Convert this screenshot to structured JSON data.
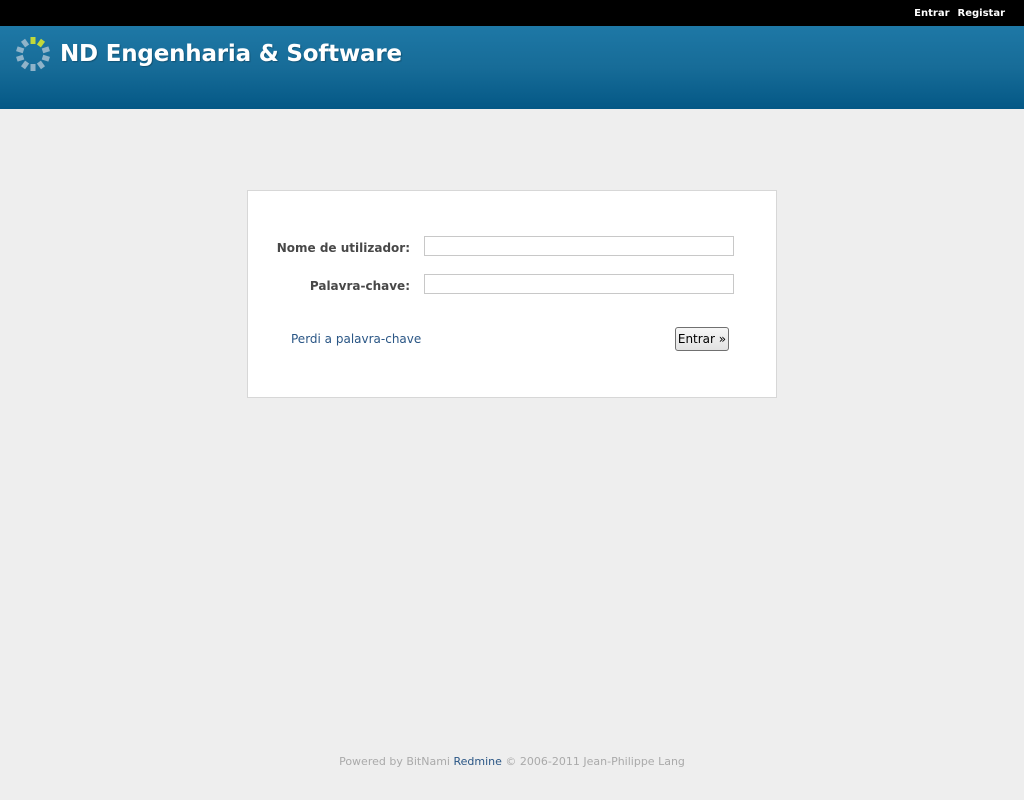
{
  "top_menu": {
    "login_label": "Entrar",
    "register_label": "Registar"
  },
  "header": {
    "title": "ND Engenharia & Software",
    "logo_icon": "spinner-logo-icon"
  },
  "login_form": {
    "username_label": "Nome de utilizador:",
    "username_value": "",
    "password_label": "Palavra-chave:",
    "password_value": "",
    "lost_password_label": "Perdi a palavra-chave",
    "submit_label": "Entrar »"
  },
  "footer": {
    "prefix": "Powered by BitNami",
    "link_label": "Redmine",
    "suffix": "© 2006-2011 Jean-Philippe Lang"
  },
  "colors": {
    "header_top": "#1e78a6",
    "header_bottom": "#045886",
    "top_menu_bg": "#000000",
    "page_bg": "#eeeeee",
    "link": "#2a5685",
    "logo_accent": "#c2d93a",
    "logo_segment": "#8fb3c9"
  }
}
